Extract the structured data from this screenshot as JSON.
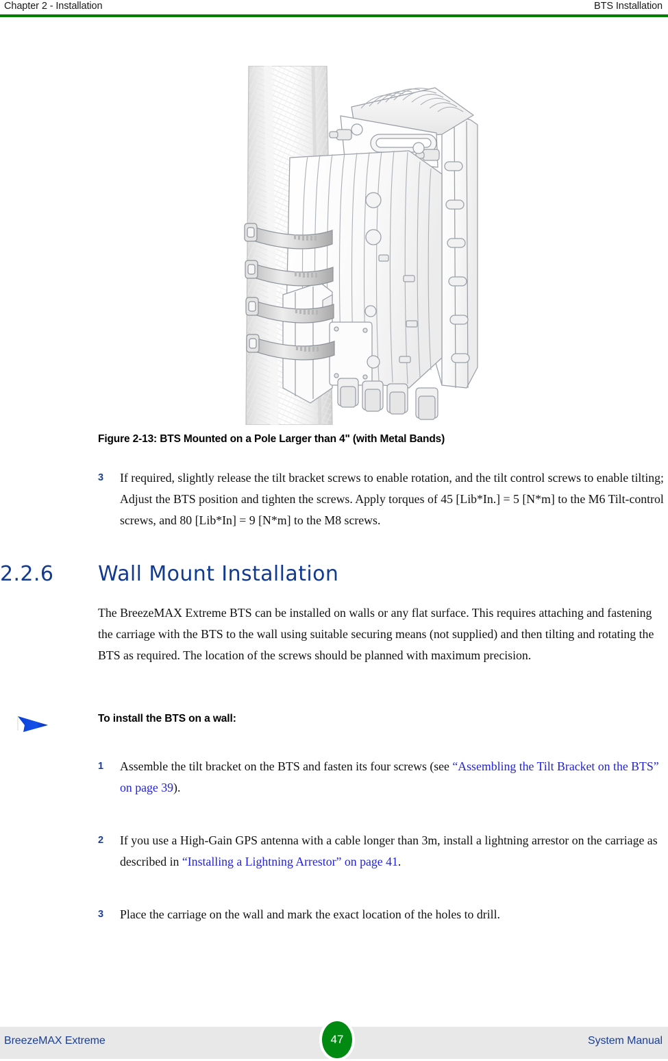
{
  "header": {
    "left": "Chapter 2 - Installation",
    "right": "BTS Installation",
    "rule_color": "#007f00"
  },
  "figure": {
    "name": "bts-mounted-on-pole-illustration",
    "alt": "Line drawing of a BTS unit mounted on a large pole using four metal bands",
    "caption": "Figure 2-13: BTS Mounted on a Pole Larger than 4\" (with Metal Bands)"
  },
  "step_3_top": {
    "number": "3",
    "text": "If required, slightly release the tilt bracket screws to enable rotation, and the tilt control screws to enable tilting; Adjust the BTS position and tighten the screws. Apply torques of 45 [Lib*In.] = 5 [N*m] to the M6 Tilt-control screws, and 80 [Lib*In] = 9 [N*m] to the M8 screws."
  },
  "section": {
    "number": "2.2.6",
    "title": "Wall Mount Installation",
    "color": "#123a8f"
  },
  "intro_paragraph": "The BreezeMAX Extreme BTS can be installed on walls or any flat surface. This requires attaching and fastening the carriage with the BTS to the wall using suitable securing means (not supplied) and then tilting and rotating the BTS as required. The location of the screws should be planned with maximum precision.",
  "procedure": {
    "arrow_icon": "blue-arrow-icon",
    "arrow_color": "#0b3fd6",
    "title": "To install the BTS on a wall:",
    "steps": [
      {
        "number": "1",
        "lead": "Assemble the tilt bracket on the BTS and fasten its four screws (see ",
        "link": "“Assembling the Tilt Bracket on the BTS” on page 39",
        "tail": ")."
      },
      {
        "number": "2",
        "lead": "If you use a High-Gain GPS antenna with a cable longer than 3m, install a lightning arrestor on the carriage as described in ",
        "link": "“Installing a Lightning Arrestor” on page 41",
        "tail": "."
      },
      {
        "number": "3",
        "lead": "Place the carriage on the wall and mark the exact location of the holes to drill.",
        "link": "",
        "tail": ""
      }
    ]
  },
  "footer": {
    "left": "BreezeMAX Extreme",
    "right": "System Manual",
    "page_number": "47",
    "badge_color": "#008a12",
    "band_color": "#e8e8e8",
    "text_color": "#1b3f94"
  }
}
